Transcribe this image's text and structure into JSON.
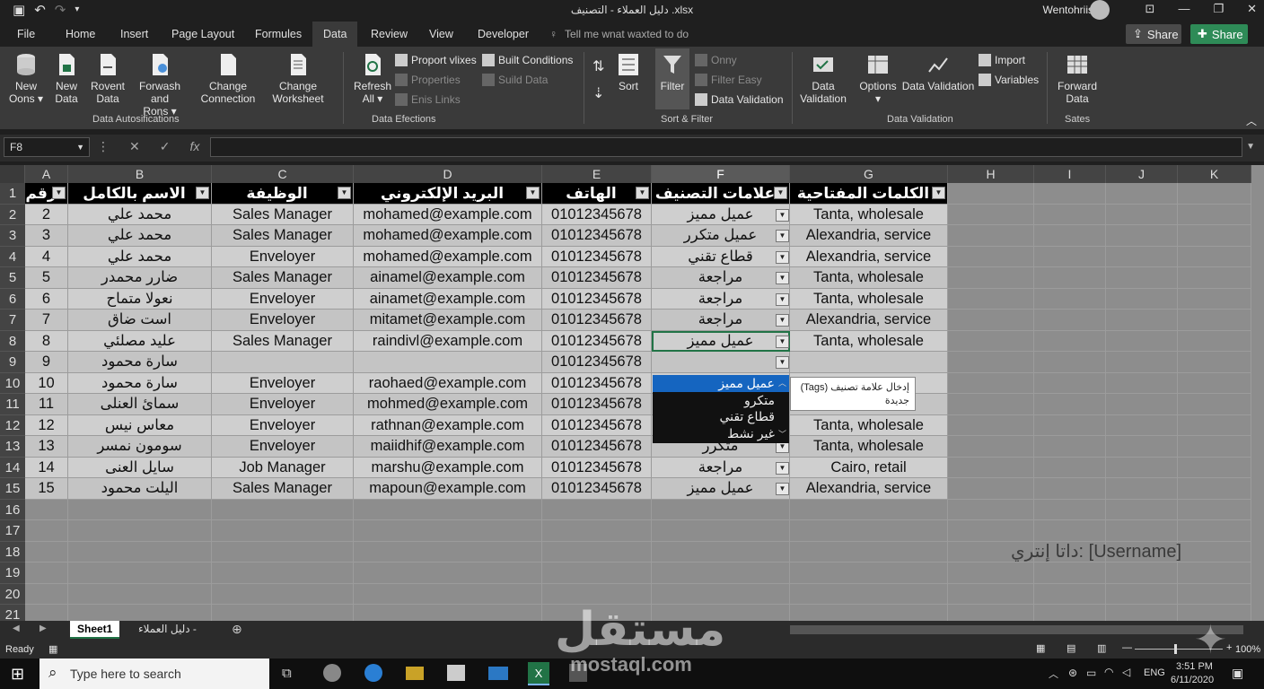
{
  "titlebar": {
    "doc_title": "دليل العملاء - التصنيف .xlsx",
    "user": "Wentohriis",
    "controls": [
      "⊡",
      "—",
      "❐",
      "✕"
    ]
  },
  "menu": {
    "tabs": [
      "File",
      "Home",
      "Insert",
      "Page Layout",
      "Formules",
      "Data",
      "Review",
      "View",
      "Developer"
    ],
    "active": "Data",
    "tell_me": "Tell me wnat waxted to do",
    "share1": "Share",
    "share2": "Share"
  },
  "ribbon": {
    "g1": {
      "buttons": [
        {
          "l1": "New",
          "l2": "Oons ▾"
        },
        {
          "l1": "New",
          "l2": "Data"
        },
        {
          "l1": "Rovent",
          "l2": "Data"
        },
        {
          "l1": "Forwash and",
          "l2": "Rons ▾"
        },
        {
          "l1": "Change",
          "l2": "Connection"
        },
        {
          "l1": "Change",
          "l2": "Worksheet"
        }
      ],
      "label": "Data Autosifications"
    },
    "g2": {
      "refresh": {
        "l1": "Refresh",
        "l2": "All ▾"
      },
      "small": [
        "Proport vlixes",
        "Properties",
        "Enis Links",
        "Built Conditions",
        "Suild Data"
      ],
      "label": "Data Efections"
    },
    "g3": {
      "sort": "Sort",
      "filter": "Filter",
      "small": [
        "Onny",
        "Filter Easy",
        "Data Validation"
      ],
      "label": "Sort & Filter"
    },
    "g4": {
      "buttons": [
        {
          "l1": "Data",
          "l2": "Validation"
        },
        {
          "l1": "Options",
          "l2": "▾"
        },
        {
          "l1": "Data Validation",
          "l2": ""
        }
      ],
      "small": [
        "Import",
        "Variables"
      ],
      "label": "Data Validation"
    },
    "g5": {
      "button": {
        "l1": "Forward",
        "l2": "Data",
        "l3": "Sates"
      }
    }
  },
  "formula": {
    "namebox": "F8",
    "fx": "fx",
    "value": ""
  },
  "columns": [
    "A",
    "B",
    "C",
    "D",
    "E",
    "F",
    "G",
    "H",
    "I",
    "J",
    "K"
  ],
  "rows": [
    "1",
    "2",
    "3",
    "4",
    "5",
    "6",
    "7",
    "8",
    "9",
    "10",
    "11",
    "12",
    "13",
    "14",
    "15",
    "16",
    "17",
    "18",
    "19",
    "20",
    "21"
  ],
  "table": {
    "headers": [
      "رقم",
      "الاسم بالكامل",
      "الوظيفة",
      "البريد الإلكتروني",
      "الهاتف",
      "علامات التصنيف",
      "الكلمات المفتاحية"
    ],
    "rows": [
      [
        "2",
        "محمد علي",
        "Sales Manager",
        "mohamed@example.com",
        "01012345678",
        "عميل مميز",
        "Tanta, wholesale"
      ],
      [
        "3",
        "محمد علي",
        "Sales Manager",
        "mohamed@example.com",
        "01012345678",
        "عميل متكرر",
        "Alexandria, service"
      ],
      [
        "4",
        "محمد علي",
        "Enveloyer",
        "mohamed@example.com",
        "01012345678",
        "قطاع تقني",
        "Alexandria, service"
      ],
      [
        "5",
        "ضارر محمدر",
        "Sales Manager",
        "ainamel@example.com",
        "01012345678",
        "مراجعة",
        "Tanta, wholesale"
      ],
      [
        "6",
        "نعولا متماح",
        "Enveloyer",
        "ainamet@example.com",
        "01012345678",
        "مراجعة",
        "Tanta, wholesale"
      ],
      [
        "7",
        "است ضاق",
        "Enveloyer",
        "mitamet@example.com",
        "01012345678",
        "مراجعة",
        "Alexandria, service"
      ],
      [
        "8",
        "عليد مصلئي",
        "Sales Manager",
        "raindivl@example.com",
        "01012345678",
        "عميل مميز",
        "Tanta, wholesale"
      ],
      [
        "9",
        "سارة محمود",
        "",
        "",
        "01012345678",
        "",
        ""
      ],
      [
        "10",
        "سارة محمود",
        "Enveloyer",
        "raohaed@example.com",
        "01012345678",
        "",
        ""
      ],
      [
        "11",
        "سمائ العنلى",
        "Enveloyer",
        "mohmed@example.com",
        "01012345678",
        "",
        ""
      ],
      [
        "12",
        "معاس نيس",
        "Enveloyer",
        "rathnan@example.com",
        "01012345678",
        "",
        "Tanta, wholesale"
      ],
      [
        "13",
        "سومون نمسر",
        "Enveloyer",
        "maiidhif@example.com",
        "01012345678",
        "متكرر",
        "Tanta, wholesale"
      ],
      [
        "14",
        "سايل العنى",
        "Job Manager",
        "marshu@example.com",
        "01012345678",
        "مراجعة",
        "Cairo, retail"
      ],
      [
        "15",
        "اليلت محمود",
        "Sales Manager",
        "mapoun@example.com",
        "01012345678",
        "عميل مميز",
        "Alexandria, service"
      ]
    ]
  },
  "dropdown": {
    "options": [
      "عميل مميز",
      "متكرو",
      "قطاع تقني",
      "غير نشط"
    ],
    "selected": 0,
    "tooltip_l1": "(Tags) إدخال علامة تصنيف",
    "tooltip_l2": "جديدة"
  },
  "floating_text": "داتا إنتري: [Username]",
  "sheets": {
    "active": "Sheet1",
    "other": "دليل العملاء -"
  },
  "status": {
    "ready": "Ready",
    "zoom": "100%"
  },
  "taskbar": {
    "search": "Type here to search",
    "lang": "ENG",
    "time": "3:51 PM",
    "date": "6/11/2020"
  },
  "watermark": {
    "arabic": "مستقل",
    "latin": "mostaql.com"
  }
}
